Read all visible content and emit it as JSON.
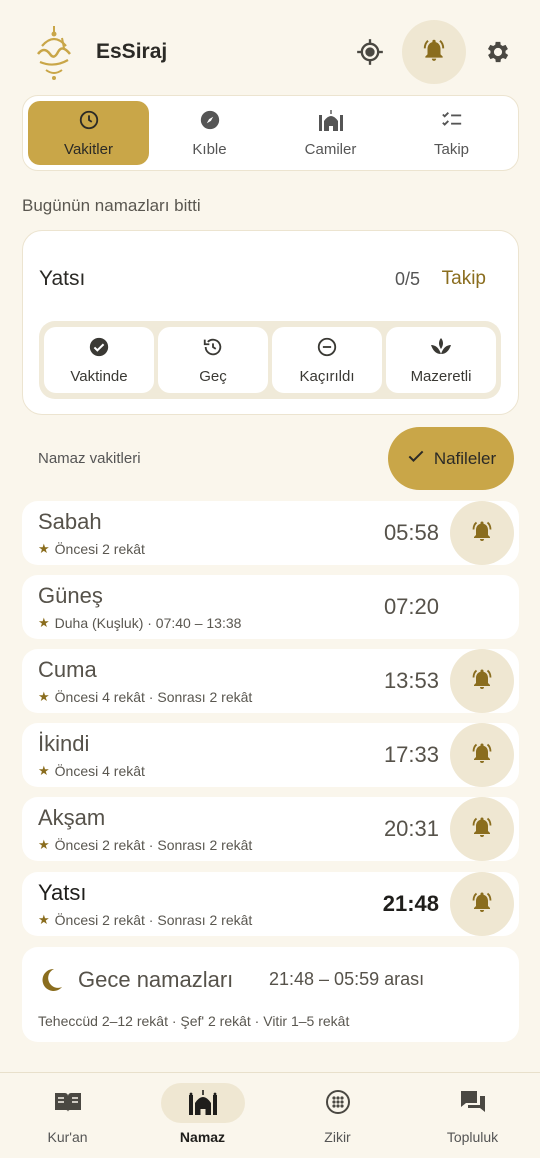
{
  "app": {
    "title": "EsSiraj"
  },
  "colors": {
    "accent": "#c9a648",
    "accent_soft": "#efe7d2",
    "bell": "#8a6d1e",
    "background": "#faf6ec"
  },
  "header": {
    "icons": [
      "gps-icon",
      "bell-icon",
      "gear-icon"
    ]
  },
  "tabs": [
    {
      "label": "Vakitler",
      "icon": "clock-icon",
      "active": true
    },
    {
      "label": "Kıble",
      "icon": "compass-icon",
      "active": false
    },
    {
      "label": "Camiler",
      "icon": "mosque-icon",
      "active": false
    },
    {
      "label": "Takip",
      "icon": "checklist-icon",
      "active": false
    }
  ],
  "status_line": "Bugünün namazları bitti",
  "tracker": {
    "prayer": "Yatsı",
    "count": "0/5",
    "link": "Takip",
    "options": [
      {
        "label": "Vaktinde",
        "icon": "check-circle-icon"
      },
      {
        "label": "Geç",
        "icon": "history-icon"
      },
      {
        "label": "Kaçırıldı",
        "icon": "minus-circle-icon"
      },
      {
        "label": "Mazeretli",
        "icon": "spa-icon"
      }
    ]
  },
  "times_section": {
    "label": "Namaz vakitleri",
    "nafile_label": "Nafileler"
  },
  "prayers": [
    {
      "name": "Sabah",
      "sub": "Öncesi 2 rekât",
      "time": "05:58",
      "bell": true,
      "current": false
    },
    {
      "name": "Güneş",
      "sub": "Duha (Kuşluk) · 07:40 – 13:38",
      "time": "07:20",
      "bell": false,
      "current": false
    },
    {
      "name": "Cuma",
      "sub": "Öncesi 4 rekât · Sonrası 2 rekât",
      "time": "13:53",
      "bell": true,
      "current": false
    },
    {
      "name": "İkindi",
      "sub": "Öncesi 4 rekât",
      "time": "17:33",
      "bell": true,
      "current": false
    },
    {
      "name": "Akşam",
      "sub": "Öncesi 2 rekât · Sonrası 2 rekât",
      "time": "20:31",
      "bell": true,
      "current": false
    },
    {
      "name": "Yatsı",
      "sub": "Öncesi 2 rekât · Sonrası 2 rekât",
      "time": "21:48",
      "bell": true,
      "current": true
    }
  ],
  "night": {
    "title": "Gece namazları",
    "range": "21:48 – 05:59 arası",
    "desc": "Teheccüd 2–12 rekât · Şef' 2 rekât · Vitir 1–5 rekât"
  },
  "bottom_nav": [
    {
      "label": "Kur'an",
      "icon": "book-icon",
      "active": false
    },
    {
      "label": "Namaz",
      "icon": "mosque-icon",
      "active": true
    },
    {
      "label": "Zikir",
      "icon": "rosary-icon",
      "active": false
    },
    {
      "label": "Topluluk",
      "icon": "forum-icon",
      "active": false
    }
  ]
}
